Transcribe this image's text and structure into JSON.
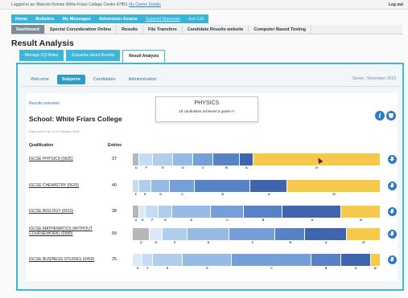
{
  "login_strip": {
    "text": "Logged in as: Malcom Roman White Friars College Centre 47851",
    "link": "My Centre Details",
    "logout": "Log out"
  },
  "main_nav": {
    "items": [
      {
        "label": "Home"
      },
      {
        "label": "Bulletins"
      },
      {
        "label": "My Messages"
      },
      {
        "label": "Administer Exams"
      },
      {
        "label": "Support Materials"
      },
      {
        "label": "Ask CIE"
      }
    ]
  },
  "sub_nav": {
    "items": [
      {
        "label": "Dashboard"
      },
      {
        "label": "Special Consideration Online"
      },
      {
        "label": "Results"
      },
      {
        "label": "File Transfers"
      },
      {
        "label": "Candidate Results website"
      },
      {
        "label": "Computer Based Testing"
      }
    ]
  },
  "page_title": "Result Analysis",
  "sec_tabs": [
    {
      "label": "Manage CQ Notes"
    },
    {
      "label": "Enquiries about Results"
    },
    {
      "label": "Result Analysis"
    }
  ],
  "panel_tabs": [
    {
      "label": "Welcome"
    },
    {
      "label": "Subjects"
    },
    {
      "label": "Candidates"
    },
    {
      "label": "Administration"
    }
  ],
  "series": "Series : November 2015",
  "results_overview": "Results overview",
  "school": "School: White Friars College",
  "data_correct": "Data correct as of 19 January 2016",
  "columns": {
    "qualification": "Qualification",
    "entries": "Entries"
  },
  "tooltip": {
    "title": "PHYSICS",
    "text": "19 candidates achieved a grade A*"
  },
  "colors": {
    "grade_u": "#b7b7b7",
    "grade_g": "#dce9f7",
    "grade_f": "#c6dcf2",
    "grade_e": "#b0cdec",
    "grade_d": "#95bbe4",
    "grade_c": "#759fd7",
    "grade_b": "#5682c6",
    "grade_a": "#3e65ad",
    "grade_astar": "#f5c94a",
    "accent": "#3db6d8"
  },
  "icons": {
    "info": "info-icon",
    "print": "print-icon",
    "download": "download-icon"
  },
  "chart_data": {
    "type": "bar",
    "stacked": true,
    "orientation": "horizontal",
    "categories": [
      "IGCSE PHYSICS (0625)",
      "IGCSE CHEMISTRY (0620)",
      "IGCSE BIOLOGY (0610)",
      "IGCSE MATHEMATICS (WITHOUT COURSEWORK) (0580)",
      "IGCSE BUSINESS STUDIES (0450)"
    ],
    "entries": [
      37,
      40,
      38,
      59,
      25
    ],
    "grade_labels": [
      "U",
      "G",
      "F",
      "E",
      "D",
      "C",
      "B",
      "A",
      "A*"
    ],
    "rows": [
      {
        "qualification": "IGCSE PHYSICS (0625)",
        "entries": "37",
        "grades": [
          "U",
          "F",
          "E",
          "D",
          "C",
          "B",
          "A",
          "A*"
        ],
        "values": [
          1,
          2,
          3,
          3,
          3,
          4,
          2,
          19
        ]
      },
      {
        "qualification": "IGCSE CHEMISTRY (0620)",
        "entries": "40",
        "grades": [
          "F",
          "E",
          "D",
          "C",
          "B",
          "A",
          "A*"
        ],
        "values": [
          1,
          2,
          3,
          4,
          9,
          6,
          15
        ]
      },
      {
        "qualification": "IGCSE BIOLOGY (0610)",
        "entries": "38",
        "grades": [
          "U",
          "G",
          "F",
          "E",
          "D",
          "C",
          "B",
          "A",
          "A*"
        ],
        "values": [
          1,
          1,
          2,
          2,
          6,
          5,
          6,
          9,
          6
        ]
      },
      {
        "qualification": "IGCSE MATHEMATICS (WITHOUT COURSEWORK) (0580)",
        "entries": "59",
        "grades": [
          "U",
          "G",
          "E",
          "D",
          "C",
          "B",
          "A",
          "A*"
        ],
        "values": [
          4,
          3,
          6,
          10,
          11,
          7,
          10,
          8
        ]
      },
      {
        "qualification": "IGCSE BUSINESS STUDIES (0450)",
        "entries": "25",
        "grades": [
          "G",
          "F",
          "E",
          "D",
          "C",
          "B",
          "A",
          "A*"
        ],
        "values": [
          1,
          1,
          3,
          5,
          8,
          3,
          3,
          1
        ]
      }
    ]
  }
}
